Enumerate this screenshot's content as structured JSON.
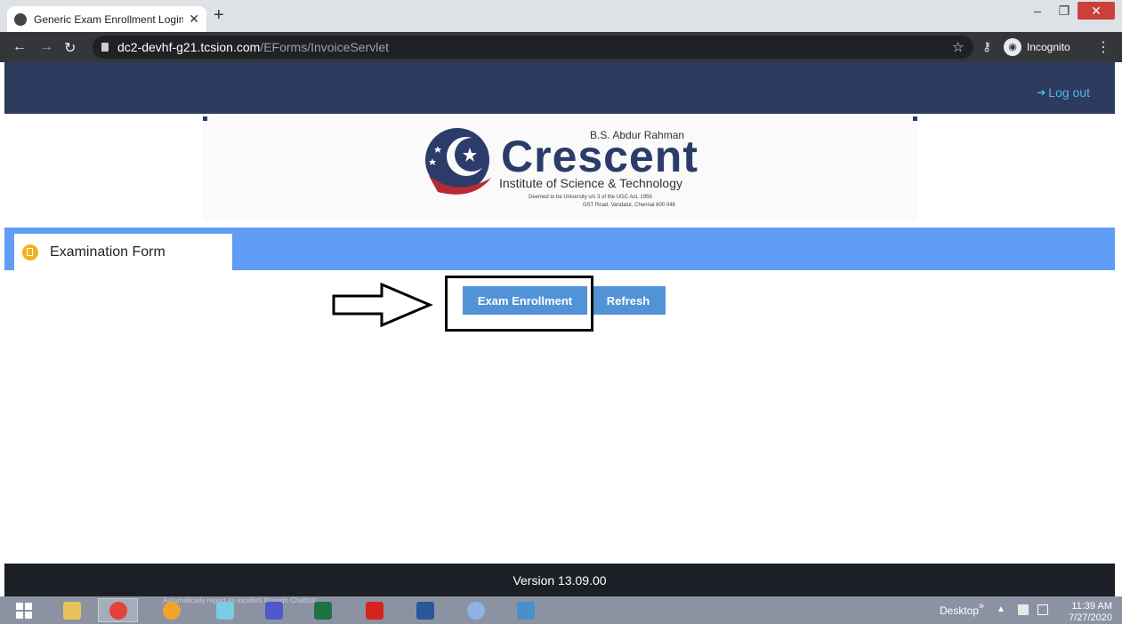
{
  "browser": {
    "tab_title": "Generic Exam Enrollment Login F",
    "tab_close": "✕",
    "new_tab": "+",
    "url_host": "dc2-devhf-g21.tcsion.com",
    "url_path": "/EForms/InvoiceServlet",
    "incognito_label": "Incognito",
    "window": {
      "minimize": "–",
      "maximize": "❐",
      "close": "✕"
    }
  },
  "header": {
    "logout_label": "Log out",
    "logout_icon": "logout-icon"
  },
  "logo": {
    "top_line": "B.S. Abdur Rahman",
    "name": "Crescent",
    "subtitle": "Institute of Science & Technology",
    "line1": "Deemed to be University u/s 3 of the UGC Act, 1956",
    "line2": "GST Road, Vandalur, Chennai 600 048"
  },
  "form_tab": {
    "label": "Examination Form"
  },
  "actions": {
    "enroll_label": "Exam Enrollment",
    "refresh_label": "Refresh"
  },
  "footer": {
    "version": "Version 13.09.00"
  },
  "taskbar": {
    "ghost_text": "Automatically report an incident through Chatbot",
    "desktop_label": "Desktop",
    "time": "11:39 AM",
    "date": "7/27/2020"
  },
  "colors": {
    "header_bg": "#2d3b5e",
    "strip_bg": "#619cf6",
    "button_bg": "#5292d6",
    "logout_text": "#4cb8f1",
    "footer_bg": "#1d1f26"
  }
}
